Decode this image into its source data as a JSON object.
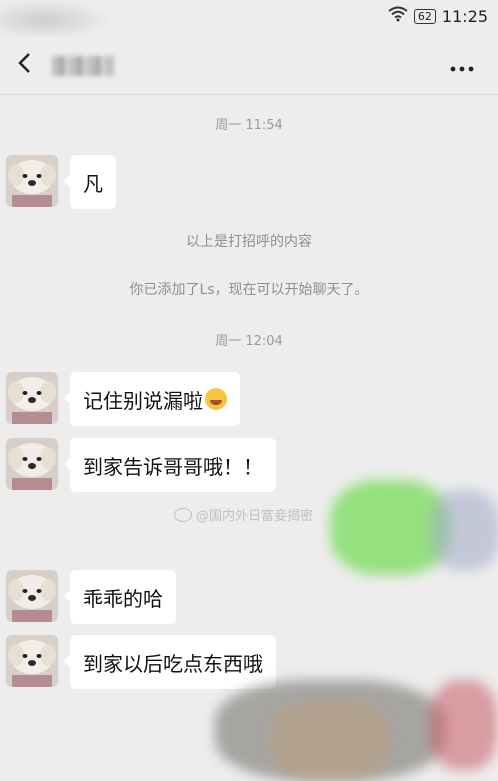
{
  "status_bar": {
    "battery": "62",
    "time": "11:25"
  },
  "nav": {
    "contact_name": ""
  },
  "messages": {
    "timestamp_1": "周一 11:54",
    "msg_1": "凡",
    "system_1": "以上是打招呼的内容",
    "system_2": "你已添加了Ls，现在可以开始聊天了。",
    "timestamp_2": "周一 12:04",
    "msg_2": "记住别说漏啦",
    "msg_3": "到家告诉哥哥哦！！",
    "msg_4": "乖乖的哈",
    "msg_5": "到家以后吃点东西哦"
  },
  "watermark": {
    "text": "@国内外日富妾揭密"
  },
  "colors": {
    "background": "#ededed",
    "bubble": "#ffffff",
    "timestamp": "#9a9a9a"
  },
  "icons": {
    "back": "chevron-left-icon",
    "more": "more-dots-icon",
    "wifi": "wifi-icon",
    "battery": "battery-icon"
  }
}
